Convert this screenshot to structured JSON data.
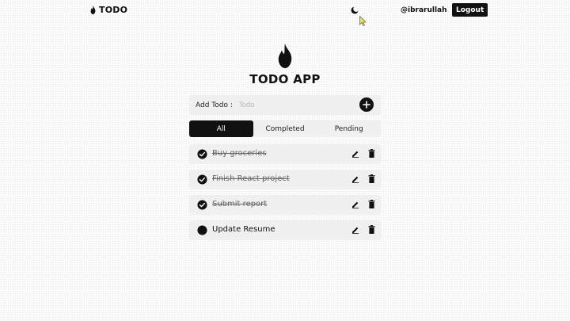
{
  "navbar": {
    "brand": "TODO",
    "username": "@ibrarullah",
    "logout_label": "Logout"
  },
  "main": {
    "title": "TODO APP",
    "add": {
      "label": "Add Todo :",
      "placeholder": "Todo"
    },
    "tabs": [
      {
        "label": "All",
        "active": true
      },
      {
        "label": "Completed",
        "active": false
      },
      {
        "label": "Pending",
        "active": false
      }
    ],
    "todos": [
      {
        "text": "Buy groceries",
        "completed": true
      },
      {
        "text": "Finish React project",
        "completed": true
      },
      {
        "text": "Submit report",
        "completed": true
      },
      {
        "text": "Update Resume",
        "completed": false
      }
    ]
  },
  "icons": {
    "brand": "flame-icon",
    "theme_toggle": "moon-icon",
    "add": "plus-circle-icon",
    "done": "check-circle-icon",
    "pending": "circle-icon",
    "edit": "pencil-icon",
    "delete": "trash-icon"
  },
  "colors": {
    "primary": "#111111",
    "card_bg": "#f0f0f0",
    "placeholder": "#b3b3b3"
  }
}
